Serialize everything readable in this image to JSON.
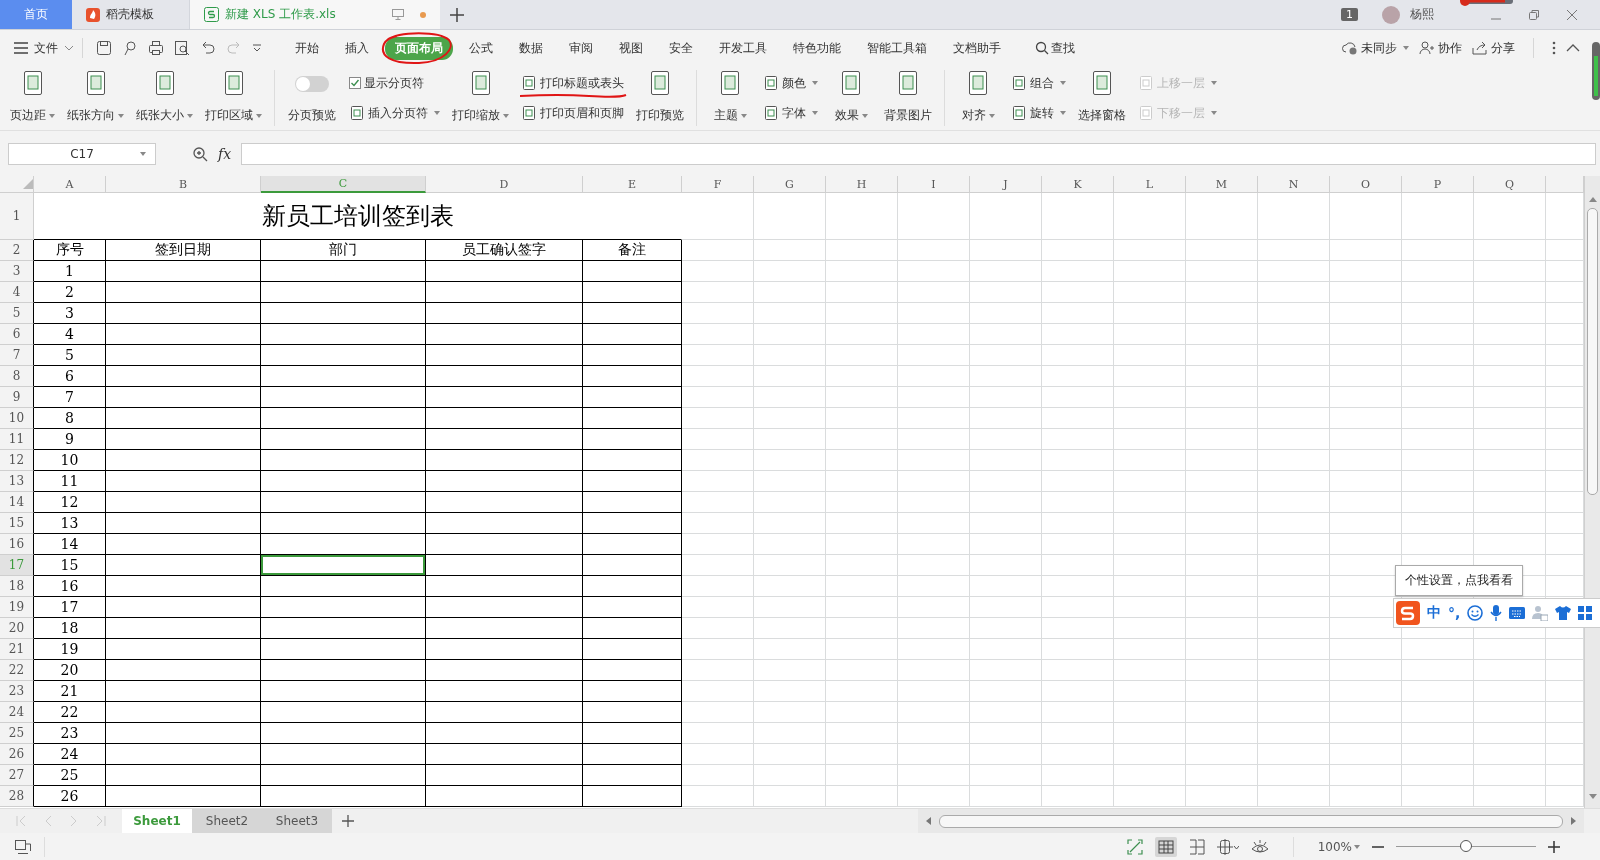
{
  "doc_tabs": [
    {
      "label": "首页",
      "kind": "home",
      "selected": false
    },
    {
      "label": "稻壳模板",
      "kind": "docer",
      "selected": false
    },
    {
      "label": "新建 XLS 工作表.xls",
      "kind": "sheet",
      "selected": true,
      "modified": true
    }
  ],
  "title_bar": {
    "badge": "1",
    "user": "杨熙"
  },
  "file_menu": "文件",
  "menu_tabs": [
    {
      "label": "开始",
      "selected": false
    },
    {
      "label": "插入",
      "selected": false
    },
    {
      "label": "页面布局",
      "selected": true
    },
    {
      "label": "公式",
      "selected": false
    },
    {
      "label": "数据",
      "selected": false
    },
    {
      "label": "审阅",
      "selected": false
    },
    {
      "label": "视图",
      "selected": false
    },
    {
      "label": "安全",
      "selected": false
    },
    {
      "label": "开发工具",
      "selected": false
    },
    {
      "label": "特色功能",
      "selected": false
    },
    {
      "label": "智能工具箱",
      "selected": false
    },
    {
      "label": "文档助手",
      "selected": false
    }
  ],
  "search": "查找",
  "menu_right": {
    "sync": "未同步",
    "collaborate": "协作",
    "share": "分享"
  },
  "ribbon": [
    [
      {
        "kind": "big",
        "label": "页边距",
        "dropdown": true
      },
      {
        "kind": "big",
        "label": "纸张方向",
        "dropdown": true
      },
      {
        "kind": "big",
        "label": "纸张大小",
        "dropdown": true
      },
      {
        "kind": "big",
        "label": "打印区域",
        "dropdown": true
      }
    ],
    [
      {
        "kind": "toggle",
        "label": "分页预览",
        "on": false
      },
      {
        "kind": "stack",
        "items": [
          {
            "kind": "checkbox",
            "label": "显示分页符",
            "checked": true
          },
          {
            "kind": "button",
            "label": "插入分页符",
            "dropdown": true
          }
        ]
      },
      {
        "kind": "big",
        "label": "打印缩放",
        "dropdown": true
      },
      {
        "kind": "stack",
        "items": [
          {
            "kind": "button",
            "label": "打印标题或表头",
            "underlined": true
          },
          {
            "kind": "button",
            "label": "打印页眉和页脚"
          }
        ]
      },
      {
        "kind": "big",
        "label": "打印预览"
      }
    ],
    [
      {
        "kind": "big",
        "label": "主题",
        "dropdown": true
      },
      {
        "kind": "stack",
        "items": [
          {
            "kind": "button",
            "label": "颜色",
            "dropdown": true
          },
          {
            "kind": "button",
            "label": "字体",
            "dropdown": true
          }
        ]
      },
      {
        "kind": "big",
        "label": "效果",
        "dropdown": true
      },
      {
        "kind": "big",
        "label": "背景图片"
      }
    ],
    [
      {
        "kind": "big",
        "label": "对齐",
        "dropdown": true
      },
      {
        "kind": "stack",
        "items": [
          {
            "kind": "button",
            "label": "组合",
            "dropdown": true
          },
          {
            "kind": "button",
            "label": "旋转",
            "dropdown": true
          }
        ]
      },
      {
        "kind": "big",
        "label": "选择窗格"
      },
      {
        "kind": "stack",
        "items": [
          {
            "kind": "button",
            "label": "上移一层",
            "dropdown": true,
            "disabled": true
          },
          {
            "kind": "button",
            "label": "下移一层",
            "dropdown": true,
            "disabled": true
          }
        ]
      }
    ]
  ],
  "formula_bar": {
    "name_box": "C17",
    "fx": "fx"
  },
  "columns": [
    {
      "label": "A",
      "selected": false
    },
    {
      "label": "B",
      "selected": false
    },
    {
      "label": "C",
      "selected": true
    },
    {
      "label": "D",
      "selected": false
    },
    {
      "label": "E",
      "selected": false
    },
    {
      "label": "F",
      "selected": false
    },
    {
      "label": "G",
      "selected": false
    },
    {
      "label": "H",
      "selected": false
    },
    {
      "label": "I",
      "selected": false
    },
    {
      "label": "J",
      "selected": false
    },
    {
      "label": "K",
      "selected": false
    },
    {
      "label": "L",
      "selected": false
    },
    {
      "label": "M",
      "selected": false
    },
    {
      "label": "N",
      "selected": false
    },
    {
      "label": "O",
      "selected": false
    },
    {
      "label": "P",
      "selected": false
    },
    {
      "label": "Q",
      "selected": false
    }
  ],
  "rows": [
    {
      "label": "1",
      "selected": false
    },
    {
      "label": "2",
      "selected": false
    },
    {
      "label": "3",
      "selected": false
    },
    {
      "label": "4",
      "selected": false
    },
    {
      "label": "5",
      "selected": false
    },
    {
      "label": "6",
      "selected": false
    },
    {
      "label": "7",
      "selected": false
    },
    {
      "label": "8",
      "selected": false
    },
    {
      "label": "9",
      "selected": false
    },
    {
      "label": "10",
      "selected": false
    },
    {
      "label": "11",
      "selected": false
    },
    {
      "label": "12",
      "selected": false
    },
    {
      "label": "13",
      "selected": false
    },
    {
      "label": "14",
      "selected": false
    },
    {
      "label": "15",
      "selected": false
    },
    {
      "label": "16",
      "selected": false
    },
    {
      "label": "17",
      "selected": true
    },
    {
      "label": "18",
      "selected": false
    },
    {
      "label": "19",
      "selected": false
    },
    {
      "label": "20",
      "selected": false
    },
    {
      "label": "21",
      "selected": false
    },
    {
      "label": "22",
      "selected": false
    },
    {
      "label": "23",
      "selected": false
    },
    {
      "label": "24",
      "selected": false
    },
    {
      "label": "25",
      "selected": false
    },
    {
      "label": "26",
      "selected": false
    },
    {
      "label": "27",
      "selected": false
    },
    {
      "label": "28",
      "selected": false
    }
  ],
  "table": {
    "title": "新员工培训签到表",
    "headers": [
      "序号",
      "签到日期",
      "部门",
      "员工确认签字",
      "备注"
    ],
    "serial_numbers": [
      "1",
      "2",
      "3",
      "4",
      "5",
      "6",
      "7",
      "8",
      "9",
      "10",
      "11",
      "12",
      "13",
      "14",
      "15",
      "16",
      "17",
      "18",
      "19",
      "20",
      "21",
      "22",
      "23",
      "24",
      "25",
      "26"
    ]
  },
  "sheets": [
    {
      "label": "Sheet1",
      "selected": true
    },
    {
      "label": "Sheet2",
      "selected": false
    },
    {
      "label": "Sheet3",
      "selected": false
    }
  ],
  "status_bar": {
    "zoom": "100%",
    "level": 0.5
  },
  "ime": {
    "tooltip": "个性设置，点我看看",
    "mode": "中",
    "punct": "°,"
  }
}
